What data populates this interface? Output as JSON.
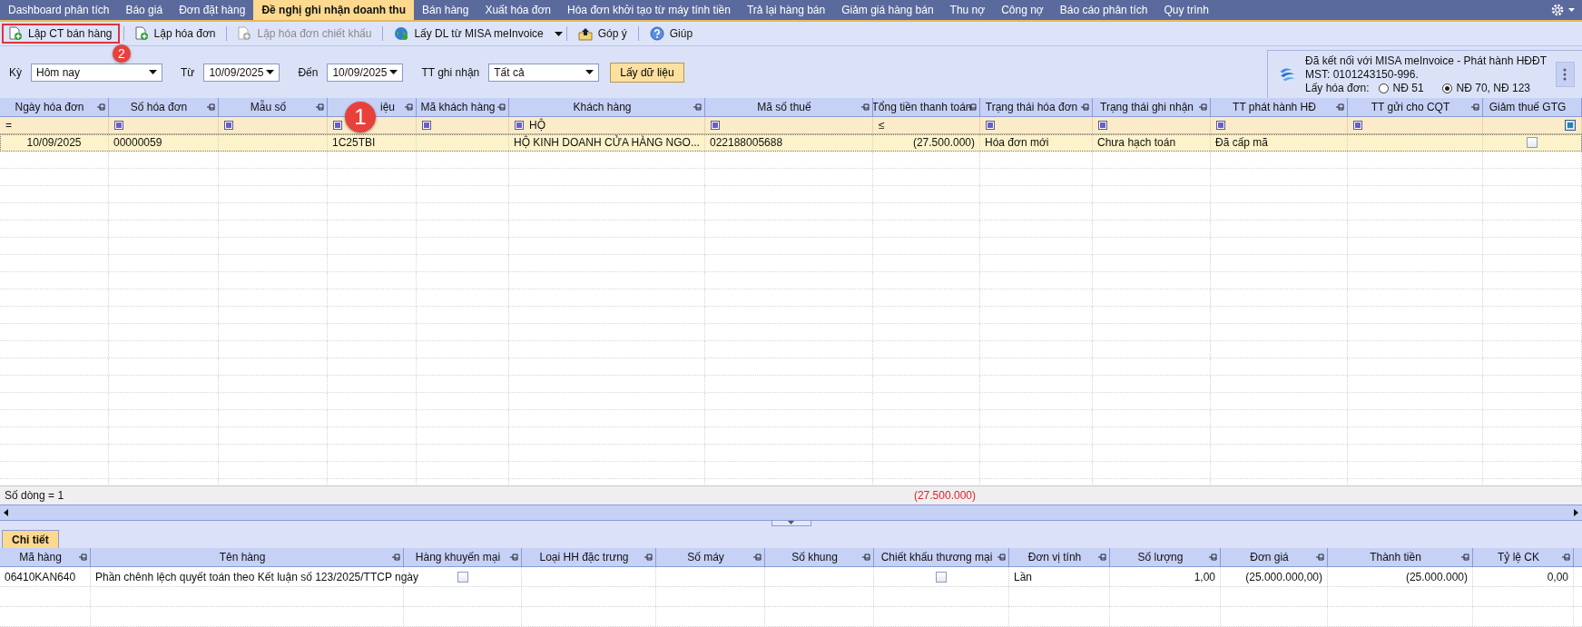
{
  "tabs": [
    {
      "label": "Dashboard phân tích",
      "selected": false
    },
    {
      "label": "Báo giá",
      "selected": false
    },
    {
      "label": "Đơn đặt hàng",
      "selected": false
    },
    {
      "label": "Đề nghị ghi nhận doanh thu",
      "selected": true
    },
    {
      "label": "Bán hàng",
      "selected": false
    },
    {
      "label": "Xuất hóa đơn",
      "selected": false
    },
    {
      "label": "Hóa đơn khởi tạo từ máy tính tiền",
      "selected": false
    },
    {
      "label": "Trả lại hàng bán",
      "selected": false
    },
    {
      "label": "Giảm giá hàng bán",
      "selected": false
    },
    {
      "label": "Thu nợ",
      "selected": false
    },
    {
      "label": "Công nợ",
      "selected": false
    },
    {
      "label": "Báo cáo phân tích",
      "selected": false
    },
    {
      "label": "Quy trình",
      "selected": false
    }
  ],
  "toolbar": [
    {
      "label": "Lập CT bán hàng",
      "disabled": false,
      "highlighted": true
    },
    {
      "label": "Lập hóa đơn",
      "disabled": false,
      "highlighted": false
    },
    {
      "label": "Lập hóa đơn chiết khấu",
      "disabled": true,
      "highlighted": false
    },
    {
      "label": "Lấy DL từ MISA meInvoice",
      "disabled": false,
      "highlighted": false,
      "dropdown": true
    },
    {
      "label": "Góp ý",
      "disabled": false,
      "highlighted": false
    },
    {
      "label": "Giúp",
      "disabled": false,
      "highlighted": false
    }
  ],
  "filters": [
    {
      "label": "Kỳ",
      "value": "Hôm nay",
      "kind": "select"
    },
    {
      "label": "Từ",
      "value": "10/09/2025",
      "kind": "date"
    },
    {
      "label": "Đến",
      "value": "10/09/2025",
      "kind": "date"
    },
    {
      "label": "TT ghi nhận",
      "value": "Tất cả",
      "kind": "status"
    }
  ],
  "fetch_button": "Lấy dữ liệu",
  "connection": {
    "status": "Đã kết nối với MISA meInvoice - Phát hành HĐĐT",
    "tax_code": "MST: 0101243150-996.",
    "invoice_label": "Lấy hóa đơn:",
    "options": [
      {
        "label": "NĐ 51",
        "selected": false
      },
      {
        "label": "NĐ 70, NĐ 123",
        "selected": true
      }
    ]
  },
  "grid": {
    "columns": [
      "Ngày hóa đơn",
      "Số hóa đơn",
      "Mẫu số",
      "iệu",
      "Mã khách hàng",
      "Khách hàng",
      "Mã số thuế",
      "Tổng tiền thanh toán",
      "Trạng thái hóa đơn",
      "Trạng thái ghi nhận",
      "TT phát hành HĐ",
      "TT gửi cho CQT",
      "Giảm thuế GTG"
    ],
    "filter_row": [
      {
        "kind": "operator",
        "text": "="
      },
      {
        "kind": "filter"
      },
      {
        "kind": "filter"
      },
      {
        "kind": "filter"
      },
      {
        "kind": "filter"
      },
      {
        "kind": "filter",
        "text": "HỘ"
      },
      {
        "kind": "filter"
      },
      {
        "kind": "operator",
        "text": "≤"
      },
      {
        "kind": "filter"
      },
      {
        "kind": "filter"
      },
      {
        "kind": "filter"
      },
      {
        "kind": "filter"
      },
      {
        "kind": "tristate",
        "indeterminate": true
      }
    ],
    "rows": [
      {
        "selected": true,
        "cells": [
          "10/09/2025",
          "00000059",
          "",
          "1C25TBI",
          "",
          "HỘ KINH DOANH CỬA HÀNG NGO...",
          "022188005688",
          "(27.500.000)",
          "Hóa đơn mới",
          "Chưa hạch toán",
          "Đã cấp mã",
          ""
        ],
        "vat_reduced": false
      }
    ],
    "footer": {
      "count": "Số dòng = 1",
      "total": "(27.500.000)"
    }
  },
  "detail": {
    "tabs": [
      {
        "label": "Chi tiết",
        "selected": true
      }
    ],
    "columns": [
      "Mã hàng",
      "Tên hàng",
      "Hàng khuyến mại",
      "Loại HH đặc trưng",
      "Số máy",
      "Số khung",
      "Chiết khấu thương mại",
      "Đơn vị tính",
      "Số lượng",
      "Đơn giá",
      "Thành tiền",
      "Tỷ lệ CK"
    ],
    "rows": [
      {
        "code": "06410KAN640",
        "name": "Phần chênh lệch quyết toán theo Kết luận số 123/2025/TTCP ngày",
        "promotion": false,
        "special_type": "",
        "machine_no": "",
        "frame_no": "",
        "trade_discount": false,
        "unit": "Lần",
        "quantity": "1,00",
        "unit_price": "(25.000.000,00)",
        "amount": "(25.000.000)",
        "discount_rate": "0,00"
      }
    ]
  },
  "callouts": [
    {
      "label": "1"
    },
    {
      "label": "2"
    }
  ]
}
